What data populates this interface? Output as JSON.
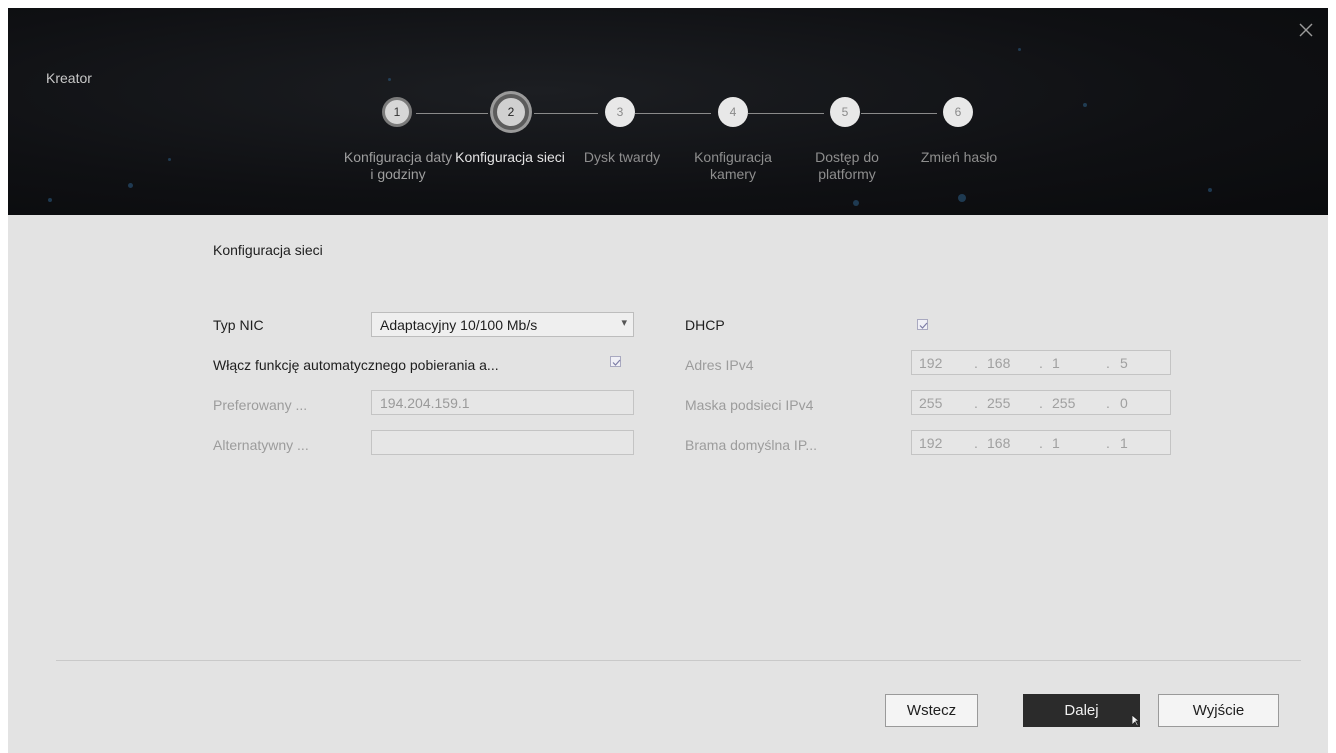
{
  "window": {
    "title": "Kreator",
    "close_icon": "close-icon"
  },
  "steps": [
    {
      "number": "1",
      "label": "Konfiguracja daty i godziny",
      "state": "done"
    },
    {
      "number": "2",
      "label": "Konfiguracja sieci",
      "state": "current"
    },
    {
      "number": "3",
      "label": "Dysk twardy",
      "state": "pending"
    },
    {
      "number": "4",
      "label": "Konfiguracja kamery",
      "state": "pending"
    },
    {
      "number": "5",
      "label": "Dostęp do platformy",
      "state": "pending"
    },
    {
      "number": "6",
      "label": "Zmień hasło",
      "state": "pending"
    }
  ],
  "section_title": "Konfiguracja sieci",
  "form": {
    "nic_type": {
      "label": "Typ NIC",
      "value": "Adaptacyjny 10/100 Mb/s",
      "arrow_icon": "chevron-down-icon"
    },
    "auto_dns": {
      "label": "Włącz funkcję automatycznego pobierania a...",
      "checked": true
    },
    "preferred_dns": {
      "label": "Preferowany ...",
      "value": "194.204.159.1"
    },
    "alternate_dns": {
      "label": "Alternatywny ...",
      "value": ""
    },
    "dhcp": {
      "label": "DHCP",
      "checked": true
    },
    "ipv4_address": {
      "label": "Adres IPv4",
      "octets": [
        "192",
        "168",
        "1",
        "5"
      ]
    },
    "ipv4_mask": {
      "label": "Maska podsieci IPv4",
      "octets": [
        "255",
        "255",
        "255",
        "0"
      ]
    },
    "ipv4_gateway": {
      "label": "Brama domyślna IP...",
      "octets": [
        "192",
        "168",
        "1",
        "1"
      ]
    }
  },
  "buttons": {
    "back": "Wstecz",
    "next": "Dalej",
    "exit": "Wyjście"
  },
  "colors": {
    "header_bg": "#0f1013",
    "body_bg": "#e3e3e3",
    "primary_button": "#2b2b2b"
  }
}
